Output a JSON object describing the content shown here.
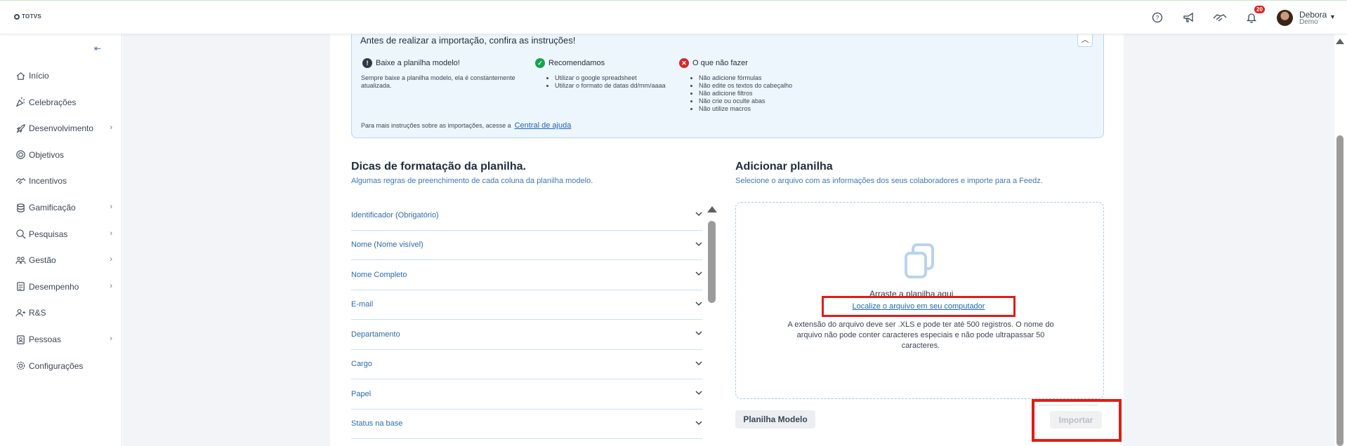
{
  "brand": {
    "logo_text": "TOTVS"
  },
  "topbar": {
    "notifications_count": "20",
    "user_name": "Debora",
    "user_role": "Demo"
  },
  "sidebar": {
    "items": [
      {
        "label": "Início",
        "icon": "home-icon",
        "has_submenu": false
      },
      {
        "label": "Celebrações",
        "icon": "party-icon",
        "has_submenu": false
      },
      {
        "label": "Desenvolvimento",
        "icon": "rocket-icon",
        "has_submenu": true
      },
      {
        "label": "Objetivos",
        "icon": "target-icon",
        "has_submenu": false
      },
      {
        "label": "Incentivos",
        "icon": "handshake-icon",
        "has_submenu": false
      },
      {
        "label": "Gamificação",
        "icon": "coins-icon",
        "has_submenu": true
      },
      {
        "label": "Pesquisas",
        "icon": "search-icon",
        "has_submenu": true
      },
      {
        "label": "Gestão",
        "icon": "people-icon",
        "has_submenu": true
      },
      {
        "label": "Desempenho",
        "icon": "clipboard-icon",
        "has_submenu": true
      },
      {
        "label": "R&S",
        "icon": "recruit-icon",
        "has_submenu": false
      },
      {
        "label": "Pessoas",
        "icon": "id-badge-icon",
        "has_submenu": true
      },
      {
        "label": "Configurações",
        "icon": "gear-icon",
        "has_submenu": false
      }
    ]
  },
  "instructions": {
    "title": "Antes de realizar a importação, confira as instruções!",
    "col1": {
      "title": "Baixe a planilha modelo!",
      "text": "Sempre baixe a planilha modelo, ela é constantemente atualizada."
    },
    "col2": {
      "title": "Recomendamos",
      "items": [
        "Utilizar o google spreadsheet",
        "Utilizar o formato de datas dd/mm/aaaa"
      ]
    },
    "col3": {
      "title": "O que não fazer",
      "items": [
        "Não adicione fórmulas",
        "Não edite os textos do cabeçalho",
        "Não adicione filtros",
        "Não crie ou oculte abas",
        "Não utilize macros"
      ]
    },
    "footer_text": "Para mais instruções sobre as importações, acesse a",
    "footer_link": "Central de ajuda"
  },
  "tips": {
    "title": "Dicas de formatação da planilha.",
    "subtitle": "Algumas regras de preenchimento de cada coluna da planilha modelo.",
    "items": [
      "Identificador (Obrigatório)",
      "Nome (Nome visível)",
      "Nome Completo",
      "E-mail",
      "Departamento",
      "Cargo",
      "Papel",
      "Status na base"
    ]
  },
  "upload": {
    "title": "Adicionar planilha",
    "subtitle": "Selecione o arquivo com as informações dos seus colaboradores e importe para a Feedz.",
    "drag_text": "Arraste a planilha aqui",
    "link": "Localize o arquivo em seu computador",
    "info": "A extensão do arquivo deve ser .XLS e pode ter até 500 registros. O nome do arquivo não pode conter caracteres especiais e não pode ultrapassar 50 caracteres."
  },
  "buttons": {
    "model": "Planilha Modelo",
    "import": "Importar"
  },
  "colors": {
    "accent": "#1f66b5",
    "highlight": "#e21b1b",
    "ok": "#17a34a",
    "error": "#d62828"
  }
}
